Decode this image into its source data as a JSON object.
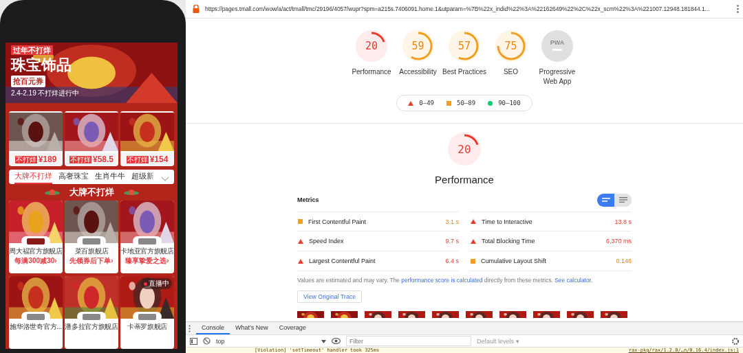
{
  "phone": {
    "banner": {
      "tag": "过年不打烊",
      "title": "珠宝饰品",
      "coupon": "抢百元券",
      "subtitle": "2.4-2.19 不打烊进行中"
    },
    "products": [
      {
        "tag": "不打烊",
        "price": "¥189"
      },
      {
        "tag": "不打烊",
        "price": "¥58.5"
      },
      {
        "tag": "不打烊",
        "price": "¥154"
      }
    ],
    "tabs": [
      {
        "label": "大牌不打烊",
        "selected": true
      },
      {
        "label": "高奢珠宝",
        "selected": false
      },
      {
        "label": "生肖牛牛",
        "selected": false
      },
      {
        "label": "超级新",
        "selected": false
      }
    ],
    "section_title": "大牌不打烊",
    "stores": [
      {
        "name": "周大福官方旗舰店",
        "promo": "每满300减30›",
        "live": false
      },
      {
        "name": "菜百旗舰店",
        "promo": "先领券后下单›",
        "live": false
      },
      {
        "name": "卡地亚官方旗舰店",
        "promo": "臻享挚爱之选›",
        "live": false
      },
      {
        "name": "施华洛世奇官方...",
        "live": false
      },
      {
        "name": "潘多拉官方旗舰店",
        "live": false
      },
      {
        "name": "卡蒂罗旗舰店",
        "live": true,
        "live_label": "直播中"
      }
    ]
  },
  "address_bar": {
    "url": "https://pages.tmall.com/wow/a/act/tmall/tmc/29196/4057/wupr?spm=a215s.7406091.home.1&utparam=%7B%22x_indid%22%3A%22162649%22%2C%22x_scm%22%3A%221007.12948.181844.1..."
  },
  "scores": [
    {
      "kind": "fail",
      "score": "20",
      "label": "Performance"
    },
    {
      "kind": "average",
      "score": "59",
      "label": "Accessibility"
    },
    {
      "kind": "average",
      "score": "57",
      "label": "Best Practices"
    },
    {
      "kind": "average",
      "score": "75",
      "label": "SEO"
    },
    {
      "kind": "na",
      "score": "PWA",
      "label": "Progressive Web App"
    }
  ],
  "legend": [
    {
      "kind": "fail",
      "label": "0–49"
    },
    {
      "kind": "average",
      "label": "50–89"
    },
    {
      "kind": "pass",
      "label": "90–100"
    }
  ],
  "performance": {
    "kind": "fail",
    "score": "20",
    "title": "Performance"
  },
  "metrics": {
    "title": "Metrics",
    "view_toggle": [
      {
        "kind": "bars",
        "selected": true
      },
      {
        "kind": "lines",
        "selected": false
      }
    ],
    "items": [
      {
        "kind": "average",
        "label": "First Contentful Paint",
        "value": "3.1 s"
      },
      {
        "kind": "fail",
        "label": "Time to Interactive",
        "value": "13.8 s"
      },
      {
        "kind": "fail",
        "label": "Speed Index",
        "value": "9.7 s"
      },
      {
        "kind": "fail",
        "label": "Total Blocking Time",
        "value": "6,370 ms"
      },
      {
        "kind": "fail",
        "label": "Largest Contentful Paint",
        "value": "6.4 s"
      },
      {
        "kind": "average",
        "label": "Cumulative Layout Shift",
        "value": "0.148"
      }
    ],
    "note": {
      "before": "Values are estimated and may vary. The ",
      "link1": "performance score is calculated",
      "middle": " directly from these metrics. ",
      "link2": "See calculator."
    },
    "button": "View Original Trace"
  },
  "devtools": {
    "tabs": [
      {
        "label": "Console",
        "selected": true
      },
      {
        "label": "What's New",
        "selected": false
      },
      {
        "label": "Coverage",
        "selected": false
      }
    ],
    "context": "top",
    "filter_placeholder": "Filter",
    "levels": "Default levels ▾",
    "message": "[Violation] 'setTimeout' handler took 325ms",
    "source": "rax-pkg/rax/1.2.0/…n/0.16.4/index.js:1"
  }
}
